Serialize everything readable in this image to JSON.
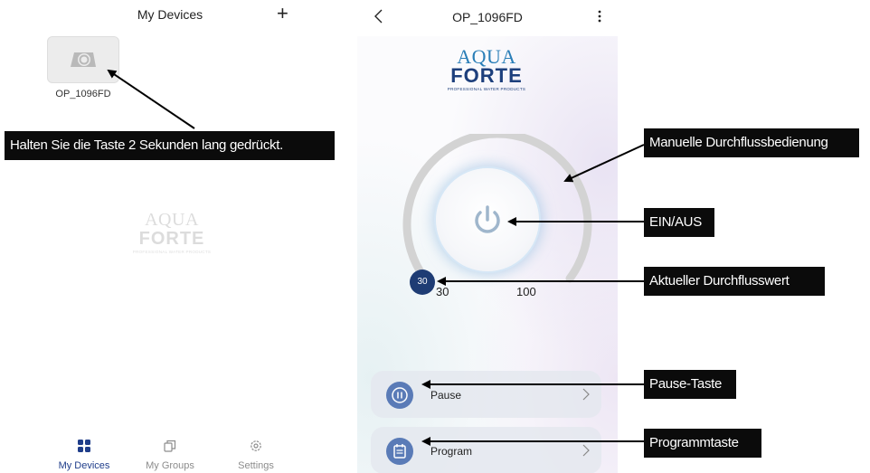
{
  "left_screen": {
    "title": "My Devices",
    "add_label": "+",
    "device": {
      "name": "OP_1096FD"
    },
    "tabs": [
      {
        "label": "My Devices",
        "icon": "grid-icon",
        "active": true
      },
      {
        "label": "My Groups",
        "icon": "groups-icon",
        "active": false
      },
      {
        "label": "Settings",
        "icon": "gear-icon",
        "active": false
      }
    ]
  },
  "right_screen": {
    "title": "OP_1096FD",
    "logo": {
      "line1": "AQUA",
      "line2": "FORTE",
      "tagline": "PROFESSIONAL WATER PRODUCTS"
    },
    "flow": {
      "current": "30",
      "min": "30",
      "max": "100"
    },
    "rows": [
      {
        "label": "Pause",
        "icon": "pause-icon"
      },
      {
        "label": "Program",
        "icon": "calendar-icon"
      }
    ]
  },
  "callouts": {
    "hold": "Halten Sie die Taste 2 Sekunden lang gedrückt.",
    "manual": "Manuelle Durchflussbedienung",
    "onoff": "EIN/AUS",
    "current": "Aktueller Durchflusswert",
    "pause": "Pause-Taste",
    "program": "Programmtaste"
  },
  "colors": {
    "accent": "#1f3d8a",
    "knob": "#1e3c74",
    "row_icon": "#5a7bb7",
    "callout_bg": "#0b0b0b"
  }
}
